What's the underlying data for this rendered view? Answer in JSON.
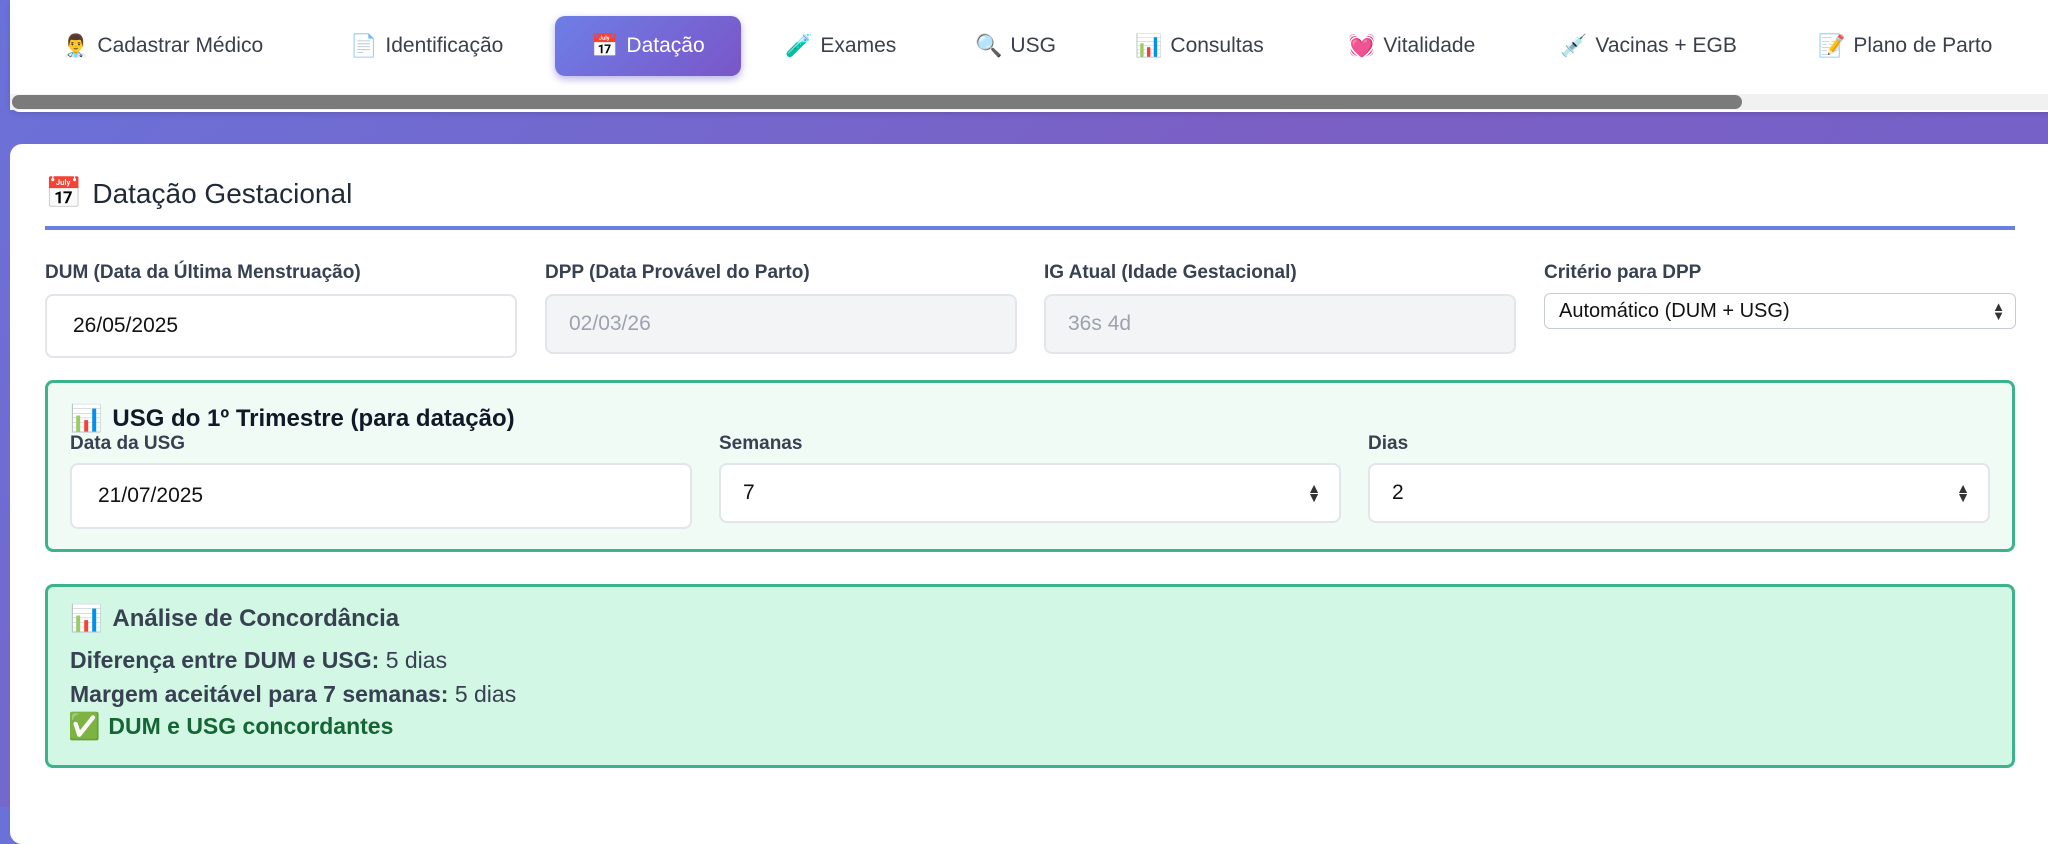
{
  "tabs": [
    {
      "icon": "👨‍⚕️",
      "label": "Cadastrar Médico"
    },
    {
      "icon": "📄",
      "label": "Identificação"
    },
    {
      "icon": "📅",
      "label": "Datação"
    },
    {
      "icon": "🧪",
      "label": "Exames"
    },
    {
      "icon": "🔍",
      "label": "USG"
    },
    {
      "icon": "📊",
      "label": "Consultas"
    },
    {
      "icon": "💓",
      "label": "Vitalidade"
    },
    {
      "icon": "💉",
      "label": "Vacinas + EGB"
    },
    {
      "icon": "📝",
      "label": "Plano de Parto"
    }
  ],
  "section": {
    "icon": "📅",
    "title": "Datação Gestacional"
  },
  "fields": {
    "dum": {
      "label": "DUM (Data da Última Menstruação)",
      "value": "26/05/2025"
    },
    "dpp": {
      "label": "DPP (Data Provável do Parto)",
      "value": "02/03/26"
    },
    "ig": {
      "label": "IG Atual (Idade Gestacional)",
      "value": "36s 4d"
    },
    "criterio": {
      "label": "Critério para DPP",
      "value": "Automático (DUM + USG)"
    }
  },
  "usg": {
    "icon": "📊",
    "title": "USG do 1º Trimestre (para datação)",
    "data_label": "Data da USG",
    "data_value": "21/07/2025",
    "semanas_label": "Semanas",
    "semanas_value": "7",
    "dias_label": "Dias",
    "dias_value": "2"
  },
  "analise": {
    "icon": "📊",
    "title": "Análise de Concordância",
    "diff_label": "Diferença entre DUM e USG:",
    "diff_value": "5 dias",
    "margem_label": "Margem aceitável para 7 semanas:",
    "margem_value": "5 dias",
    "status_icon": "✅",
    "status": "DUM e USG concordantes"
  },
  "colors": {
    "accent": "#6b7fe0",
    "success_border": "#3cb38c",
    "success_bg": "#d2f7e4"
  }
}
